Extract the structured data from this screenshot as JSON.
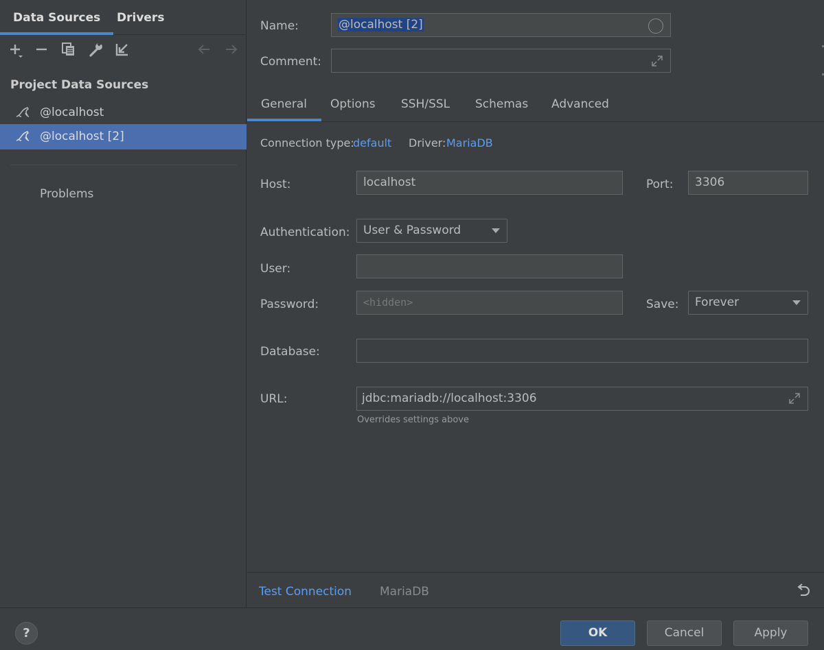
{
  "left": {
    "tabs": [
      "Data Sources",
      "Drivers"
    ],
    "section_title": "Project Data Sources",
    "items": [
      {
        "label": "@localhost",
        "selected": false
      },
      {
        "label": "@localhost [2]",
        "selected": true
      }
    ],
    "problems": "Problems"
  },
  "form": {
    "name_label": "Name:",
    "name_value": "@localhost [2]",
    "comment_label": "Comment:",
    "comment_value": "",
    "tabs": [
      "General",
      "Options",
      "SSH/SSL",
      "Schemas",
      "Advanced"
    ],
    "active_tab": "General",
    "connection_type_label": "Connection type:",
    "connection_type_value": "default",
    "driver_label": "Driver:",
    "driver_value": "MariaDB",
    "host_label": "Host:",
    "host_value": "localhost",
    "port_label": "Port:",
    "port_value": "3306",
    "auth_label": "Authentication:",
    "auth_value": "User & Password",
    "user_label": "User:",
    "user_value": "",
    "password_label": "Password:",
    "password_placeholder": "<hidden>",
    "save_label": "Save:",
    "save_value": "Forever",
    "database_label": "Database:",
    "database_value": "",
    "url_label": "URL:",
    "url_value": "jdbc:mariadb://localhost:3306",
    "url_hint": "Overrides settings above"
  },
  "bottom": {
    "test_connection": "Test Connection",
    "driver_name": "MariaDB"
  },
  "footer": {
    "help": "?",
    "ok": "OK",
    "cancel": "Cancel",
    "apply": "Apply"
  },
  "colors": {
    "accent": "#4a88c7",
    "link": "#589df6",
    "selection": "#4b6eaf",
    "background": "#3c3f41"
  },
  "icons": {
    "toolbar": [
      "add-icon",
      "remove-icon",
      "duplicate-icon",
      "wrench-icon",
      "import-icon",
      "back-icon",
      "forward-icon"
    ],
    "tree_item": "mariadb-seal-icon",
    "revert": "revert-icon"
  }
}
